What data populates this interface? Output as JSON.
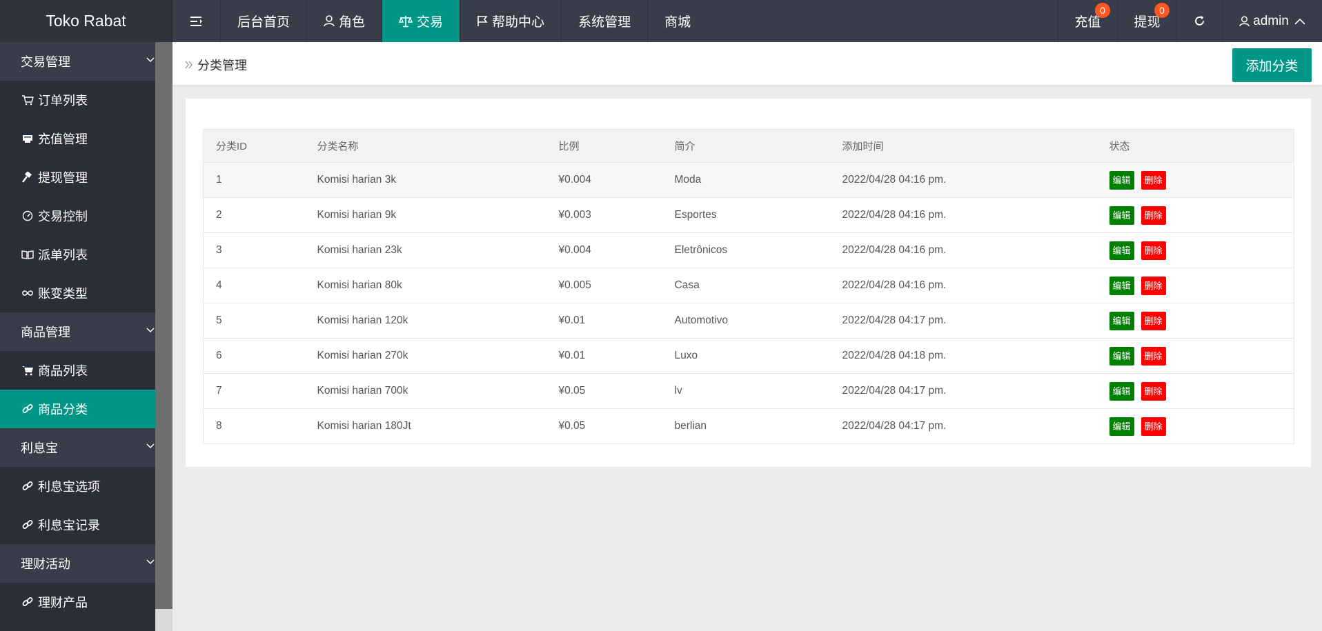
{
  "app": {
    "title": "Toko Rabat"
  },
  "topnav": [
    {
      "label": "后台首页",
      "icon": ""
    },
    {
      "label": "角色",
      "icon": "user-icon"
    },
    {
      "label": "交易",
      "icon": "scale-icon",
      "active": true
    },
    {
      "label": "帮助中心",
      "icon": "flag-icon"
    },
    {
      "label": "系统管理",
      "icon": ""
    },
    {
      "label": "商城",
      "icon": ""
    }
  ],
  "topright": {
    "recharge": {
      "label": "充值",
      "count": "0"
    },
    "withdraw": {
      "label": "提现",
      "count": "0"
    },
    "refresh_icon": "refresh-icon",
    "user": "admin"
  },
  "sidebar": {
    "groups": [
      {
        "label": "交易管理",
        "items": [
          {
            "label": "订单列表",
            "icon": "cart-icon"
          },
          {
            "label": "充值管理",
            "icon": "card-icon"
          },
          {
            "label": "提现管理",
            "icon": "hammer-icon"
          },
          {
            "label": "交易控制",
            "icon": "gauge-icon"
          },
          {
            "label": "派单列表",
            "icon": "book-icon"
          },
          {
            "label": "账变类型",
            "icon": "infinity-icon"
          }
        ]
      },
      {
        "label": "商品管理",
        "items": [
          {
            "label": "商品列表",
            "icon": "cart-icon"
          },
          {
            "label": "商品分类",
            "icon": "link-icon",
            "active": true
          }
        ]
      },
      {
        "label": "利息宝",
        "items": [
          {
            "label": "利息宝选项",
            "icon": "link-icon"
          },
          {
            "label": "利息宝记录",
            "icon": "link-icon"
          }
        ]
      },
      {
        "label": "理财活动",
        "items": [
          {
            "label": "理财产品",
            "icon": "link-icon"
          }
        ]
      }
    ]
  },
  "breadcrumb": {
    "label": "分类管理"
  },
  "actions": {
    "add_label": "添加分类"
  },
  "table": {
    "headers": [
      "分类ID",
      "分类名称",
      "比例",
      "简介",
      "添加时间",
      "状态"
    ],
    "edit_label": "编辑",
    "delete_label": "删除",
    "rows": [
      {
        "id": "1",
        "name": "Komisi harian 3k",
        "ratio": "¥0.004",
        "desc": "Moda",
        "time": "2022/04/28 04:16 pm."
      },
      {
        "id": "2",
        "name": "Komisi harian 9k",
        "ratio": "¥0.003",
        "desc": "Esportes",
        "time": "2022/04/28 04:16 pm."
      },
      {
        "id": "3",
        "name": "Komisi harian 23k",
        "ratio": "¥0.004",
        "desc": "Eletrônicos",
        "time": "2022/04/28 04:16 pm."
      },
      {
        "id": "4",
        "name": "Komisi harian 80k",
        "ratio": "¥0.005",
        "desc": "Casa",
        "time": "2022/04/28 04:16 pm."
      },
      {
        "id": "5",
        "name": "Komisi harian 120k",
        "ratio": "¥0.01",
        "desc": "Automotivo",
        "time": "2022/04/28 04:17 pm."
      },
      {
        "id": "6",
        "name": "Komisi harian 270k",
        "ratio": "¥0.01",
        "desc": "Luxo",
        "time": "2022/04/28 04:18 pm."
      },
      {
        "id": "7",
        "name": "Komisi harian 700k",
        "ratio": "¥0.05",
        "desc": "lv",
        "time": "2022/04/28 04:17 pm."
      },
      {
        "id": "8",
        "name": "Komisi harian 180Jt",
        "ratio": "¥0.05",
        "desc": "berlian",
        "time": "2022/04/28 04:17 pm."
      }
    ]
  },
  "colors": {
    "accent": "#009688",
    "topbar": "#393d49",
    "sidebar": "#2b2e38",
    "edit": "#008000",
    "delete": "#ff0000",
    "badge": "#ff5722"
  }
}
